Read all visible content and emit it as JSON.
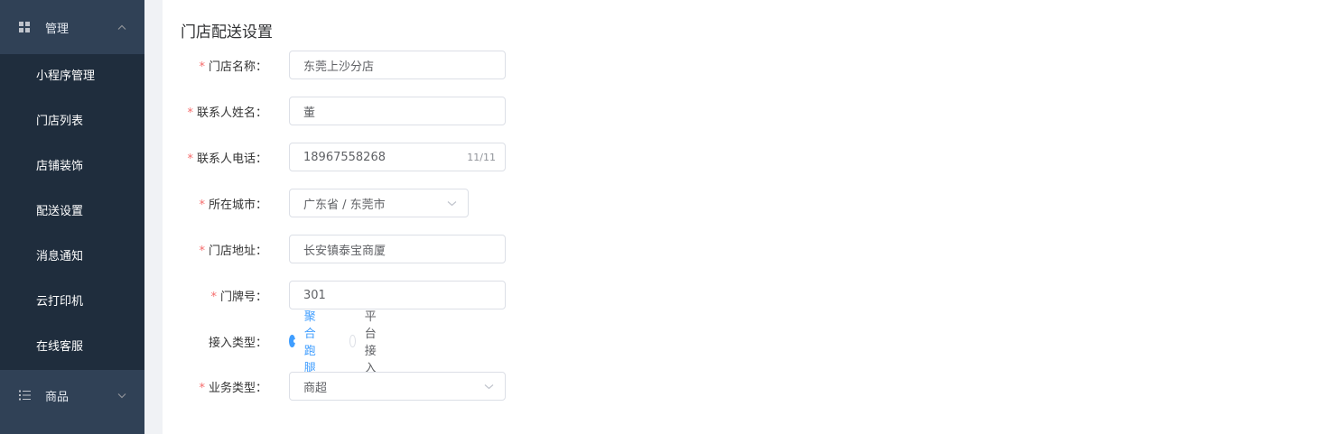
{
  "sidebar": {
    "manage_label": "管理",
    "manage_items": [
      {
        "label": "小程序管理"
      },
      {
        "label": "门店列表"
      },
      {
        "label": "店铺装饰"
      },
      {
        "label": "配送设置"
      },
      {
        "label": "消息通知"
      },
      {
        "label": "云打印机"
      },
      {
        "label": "在线客服"
      }
    ],
    "goods_label": "商品"
  },
  "form": {
    "title": "门店配送设置",
    "store_name": {
      "label": "门店名称：",
      "value": "东莞上沙分店"
    },
    "contact_name": {
      "label": "联系人姓名：",
      "value": "董"
    },
    "contact_phone": {
      "label": "联系人电话：",
      "value": "18967558268",
      "counter": "11/11"
    },
    "city": {
      "label": "所在城市：",
      "value": "广东省 / 东莞市"
    },
    "address": {
      "label": "门店地址：",
      "value": "长安镇泰宝商厦"
    },
    "door_number": {
      "label": "门牌号：",
      "value": "301"
    },
    "access_type": {
      "label": "接入类型：",
      "options": [
        "聚合跑腿",
        "平台接入"
      ],
      "selected": "聚合跑腿"
    },
    "business_type": {
      "label": "业务类型：",
      "value": "商超"
    }
  },
  "colors": {
    "sidebar_bg": "#304156",
    "submenu_bg": "#1f2d3d",
    "accent": "#409eff",
    "required": "#f56c6c"
  }
}
